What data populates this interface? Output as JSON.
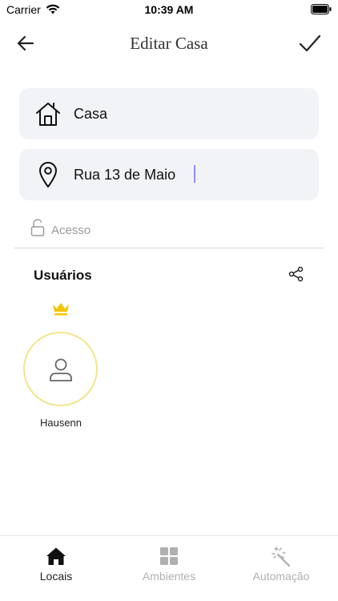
{
  "status_bar": {
    "carrier": "Carrier",
    "time": "10:39 AM"
  },
  "nav": {
    "title": "Editar Casa",
    "back_icon": "arrow-left-icon",
    "confirm_icon": "checkmark-icon"
  },
  "form": {
    "name": {
      "value": "Casa",
      "icon": "house-icon"
    },
    "address": {
      "value": "Rua 13 de Maio",
      "icon": "map-pin-icon"
    },
    "access": {
      "label": "Acesso",
      "icon": "unlock-icon"
    }
  },
  "users": {
    "title": "Usuários",
    "share_icon": "share-icon",
    "list": [
      {
        "name": "Hausenn",
        "role_icon": "crown-icon",
        "avatar_icon": "user-icon"
      }
    ]
  },
  "tabs": [
    {
      "label": "Locais",
      "icon": "house-filled-icon",
      "active": true
    },
    {
      "label": "Ambientes",
      "icon": "grid-icon",
      "active": false
    },
    {
      "label": "Automação",
      "icon": "magic-wand-icon",
      "active": false
    }
  ],
  "colors": {
    "accent_crown": "#f5c400",
    "avatar_ring": "#f2e58a",
    "field_bg": "#f2f3f7",
    "tab_inactive": "#b0b0b0"
  }
}
